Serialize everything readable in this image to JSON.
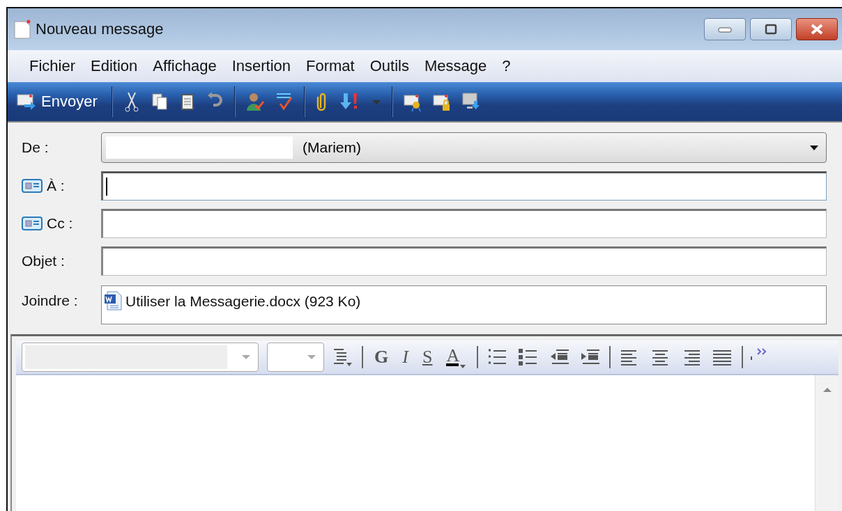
{
  "window": {
    "title": "Nouveau message"
  },
  "menu": [
    "Fichier",
    "Edition",
    "Affichage",
    "Insertion",
    "Format",
    "Outils",
    "Message",
    "?"
  ],
  "toolbar": {
    "send_label": "Envoyer"
  },
  "fields": [
    {
      "kind": "dropdown",
      "label": "De :",
      "value": "(Mariem)"
    },
    {
      "kind": "address",
      "label": "À :",
      "focused": true
    },
    {
      "kind": "address",
      "label": "Cc :",
      "focused": false
    },
    {
      "kind": "text",
      "label": "Objet :",
      "focused": false
    },
    {
      "kind": "attachment",
      "label": "Joindre :",
      "value": "Utiliser la Messagerie.docx (923 Ko)"
    }
  ],
  "format_toolbar": {
    "letters": [
      {
        "kind": "bold",
        "text": "G"
      },
      {
        "kind": "italic",
        "text": "I"
      },
      {
        "kind": "underline",
        "text": "S"
      },
      {
        "kind": "color",
        "text": "A"
      }
    ]
  }
}
